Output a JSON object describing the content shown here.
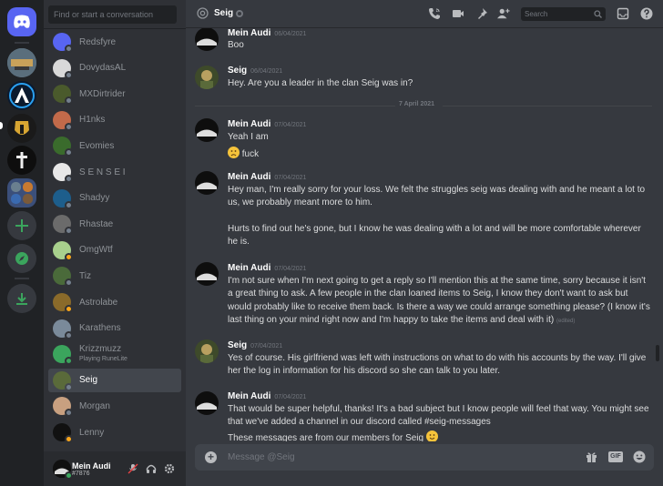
{
  "sidebar": {
    "search_placeholder": "Find or start a conversation",
    "dms": [
      {
        "name": "Redsfyre",
        "status": "offline",
        "status_color": "#747f8d",
        "avatar_color": "#5865f2"
      },
      {
        "name": "DovydasAL",
        "status": "offline",
        "status_color": "#747f8d",
        "avatar_color": "#d9d9d9"
      },
      {
        "name": "MXDirtrider",
        "status": "offline",
        "status_color": "#747f8d",
        "avatar_color": "#4a5a2c"
      },
      {
        "name": "H1nks",
        "status": "offline",
        "status_color": "#747f8d",
        "avatar_color": "#c26a4a"
      },
      {
        "name": "Evomies",
        "status": "offline",
        "status_color": "#747f8d",
        "avatar_color": "#3a6b2c"
      },
      {
        "name": "S E N S E I",
        "status": "offline",
        "status_color": "#747f8d",
        "avatar_color": "#e8e8e8"
      },
      {
        "name": "Shadyy",
        "status": "offline",
        "status_color": "#747f8d",
        "avatar_color": "#1d5e8c"
      },
      {
        "name": "Rhastae",
        "status": "offline",
        "status_color": "#747f8d",
        "avatar_color": "#6b6b6b"
      },
      {
        "name": "OmgWtf",
        "status": "idle",
        "status_color": "#faa61a",
        "avatar_color": "#a8d08d"
      },
      {
        "name": "Tiz",
        "status": "offline",
        "status_color": "#747f8d",
        "avatar_color": "#4a6a3a"
      },
      {
        "name": "Astrolabe",
        "status": "idle",
        "status_color": "#faa61a",
        "avatar_color": "#8a6a2a"
      },
      {
        "name": "Karathens",
        "status": "offline",
        "status_color": "#747f8d",
        "avatar_color": "#7a8a9a"
      },
      {
        "name": "Krizzmuzz",
        "status": "online",
        "status_color": "#3ba55d",
        "avatar_color": "#3ba55d",
        "activity": "Playing RuneLite"
      },
      {
        "name": "Seig",
        "status": "offline",
        "status_color": "#747f8d",
        "avatar_color": "#5a6a3a"
      },
      {
        "name": "Morgan",
        "status": "offline",
        "status_color": "#747f8d",
        "avatar_color": "#c8a080"
      },
      {
        "name": "Lenny",
        "status": "idle",
        "status_color": "#faa61a",
        "avatar_color": "#111111"
      }
    ],
    "user": {
      "name": "Mein Audi",
      "tag": "#7876",
      "status_color": "#3ba55d"
    }
  },
  "header": {
    "channel_name": "Seig",
    "search_placeholder": "Search"
  },
  "messages": [
    {
      "author": "Mein Audi",
      "time": "06/04/2021",
      "text": "Boo"
    },
    {
      "author": "Seig",
      "time": "06/04/2021",
      "text": "Hey. Are you a leader in the clan Seig was in?"
    },
    {
      "author": "Mein Audi",
      "time": "07/04/2021",
      "text": "Yeah I am",
      "text2": "fuck"
    },
    {
      "author": "Mein Audi",
      "time": "07/04/2021",
      "text": "Hey man, I'm really sorry for your loss. We felt the struggles seig was dealing with and he meant a lot to us, we probably meant more to him.",
      "text2": "Hurts to find out he's gone, but I know he was dealing with a lot and will be more comfortable wherever he is."
    },
    {
      "author": "Mein Audi",
      "time": "07/04/2021",
      "text": "I'm not sure when I'm next going to get a reply so I'll mention this at the same time, sorry because it isn't a great thing to ask. A few people in the clan loaned items to Seig, I know they don't want to ask but would probably like to receive them back. Is there a way we could arrange something please? (I know it's last thing on your mind right now and I'm happy to take the items and deal with it)",
      "edited": "(edited)"
    },
    {
      "author": "Seig",
      "time": "07/04/2021",
      "text": "Yes of course. His girlfriend was left with instructions on what to do with his accounts by the way. I'll give her the log in information for his discord so she can talk to you later."
    },
    {
      "author": "Mein Audi",
      "time": "07/04/2021",
      "text": "That would be super helpful, thanks! It's a bad subject but I know people will feel that way. You might see that we've added a channel in our discord called #seig-messages",
      "text2": "These messages are from our members for Seig"
    }
  ],
  "date_divider": "7 April 2021",
  "composer": {
    "placeholder": "Message @Seig",
    "gif_label": "GIF"
  }
}
